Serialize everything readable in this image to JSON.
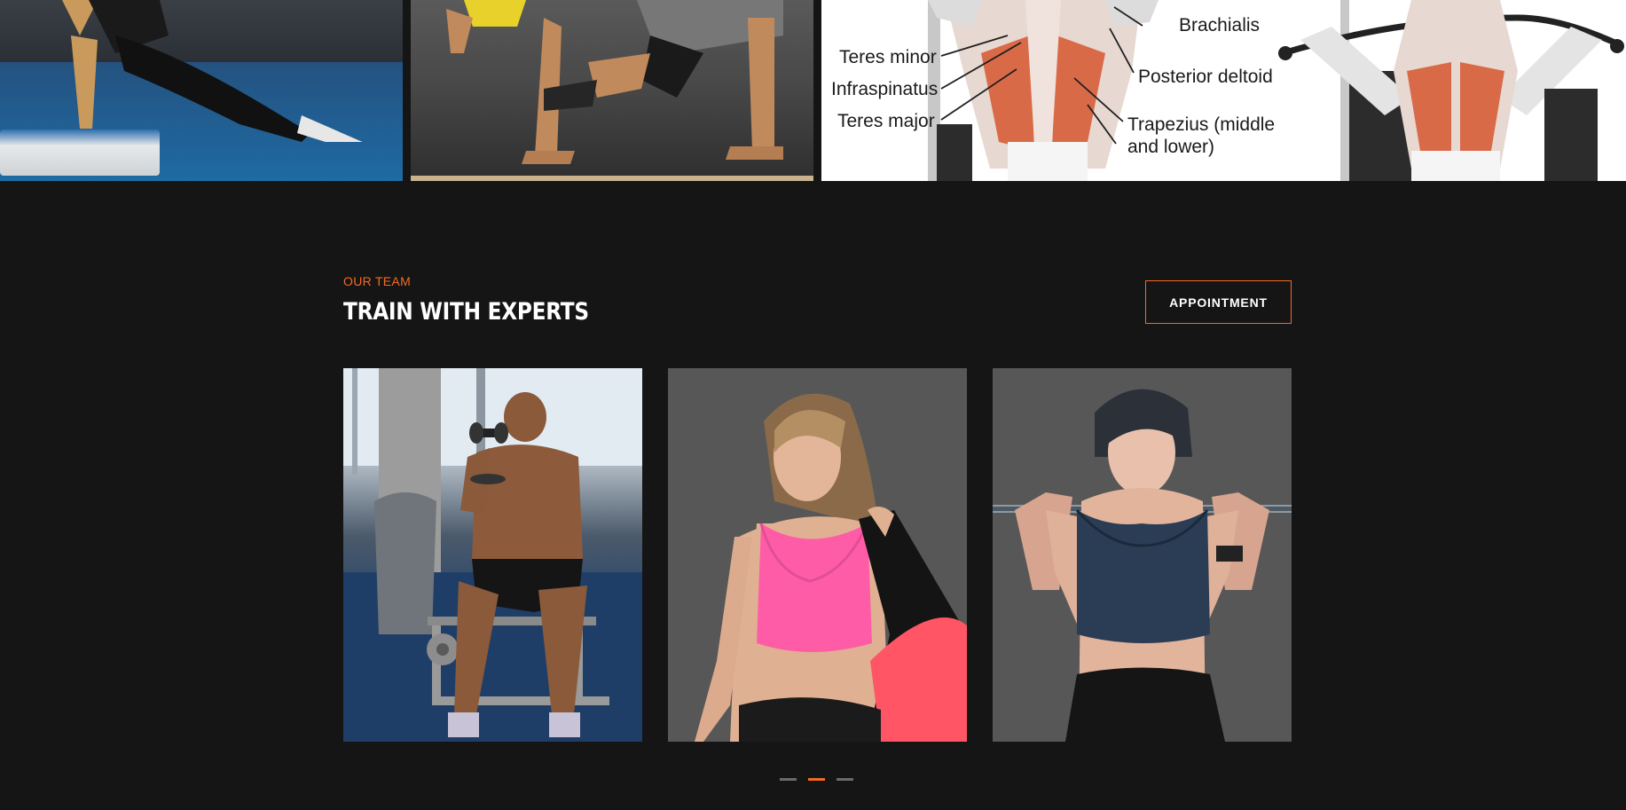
{
  "gallery": {
    "anatomy_labels": {
      "teres_minor": "Teres minor",
      "infraspinatus": "Infraspinatus",
      "teres_major": "Teres major",
      "brachialis": "Brachialis",
      "posterior_deltoid": "Posterior deltoid",
      "trapezius": "Trapezius (middle\nand lower)"
    }
  },
  "team": {
    "eyebrow": "OUR TEAM",
    "title": "TRAIN WITH EXPERTS",
    "appointment_label": "APPOINTMENT",
    "trainers": [
      {
        "photo": "man-with-dumbbell"
      },
      {
        "photo": "woman-pink-top"
      },
      {
        "photo": "woman-with-barbell"
      }
    ],
    "carousel": {
      "pages": 3,
      "active_index": 1
    }
  },
  "colors": {
    "accent": "#f36b21",
    "background": "#151515",
    "card_gray": "#575757"
  }
}
